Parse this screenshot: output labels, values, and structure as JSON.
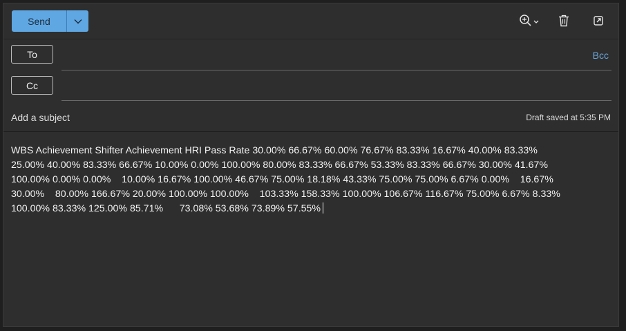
{
  "toolbar": {
    "send_label": "Send",
    "icons": [
      "chevron-down-icon",
      "zoom-icon",
      "trash-icon",
      "popout-icon"
    ]
  },
  "recipients": {
    "to_label": "To",
    "cc_label": "Cc",
    "bcc_label": "Bcc",
    "to_value": "",
    "cc_value": ""
  },
  "subject": {
    "placeholder": "Add a subject",
    "value": "",
    "status": "Draft saved at 5:35 PM"
  },
  "body": {
    "lines": [
      "WBS Achievement Shifter Achievement HRI Pass Rate 30.00% 66.67% 60.00% 76.67% 83.33% 16.67% 40.00% 83.33%",
      "25.00% 40.00% 83.33% 66.67% 10.00% 0.00% 100.00% 80.00% 83.33% 66.67% 53.33% 83.33% 66.67% 30.00% 41.67%",
      "100.00% 0.00% 0.00%    10.00% 16.67% 100.00% 46.67% 75.00% 18.18% 43.33% 75.00% 75.00% 6.67% 0.00%    16.67%",
      "30.00%    80.00% 166.67% 20.00% 100.00% 100.00%    103.33% 158.33% 100.00% 106.67% 116.67% 75.00% 6.67% 8.33%",
      "100.00% 83.33% 125.00% 85.71%      73.08% 53.68% 73.89% 57.55%"
    ]
  },
  "colors": {
    "accent": "#5fa7e3",
    "link": "#6ba6dd",
    "background": "#2e2e2e"
  }
}
